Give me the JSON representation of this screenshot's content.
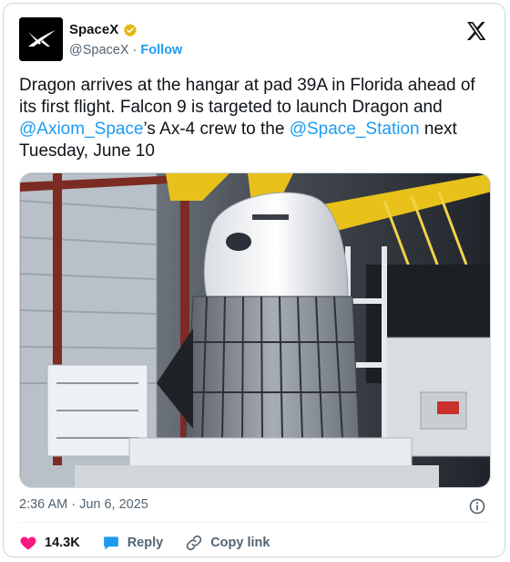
{
  "account": {
    "name": "SpaceX",
    "handle": "@SpaceX",
    "separator": " · ",
    "follow_label": "Follow"
  },
  "tweet": {
    "text_parts": {
      "p1": "Dragon arrives at the hangar at pad 39A in Florida ahead of its first flight. Falcon 9 is targeted to launch Dragon and ",
      "m1": "@Axiom_Space",
      "p2": "’s Ax-4 crew to the ",
      "m2": "@Space_Station",
      "p3": " next Tuesday, June 10"
    },
    "timestamp": "2:36 AM · Jun 6, 2025"
  },
  "actions": {
    "likes": "14.3K",
    "reply_label": "Reply",
    "copy_link_label": "Copy link"
  },
  "colors": {
    "link_blue": "#1d9bf0",
    "like_pink": "#f91880",
    "muted_gray": "#536471",
    "verified_gold": "#e2b719"
  },
  "icons": [
    "x-logo-icon",
    "verified-badge-icon",
    "info-icon",
    "heart-icon",
    "reply-icon",
    "link-icon"
  ]
}
